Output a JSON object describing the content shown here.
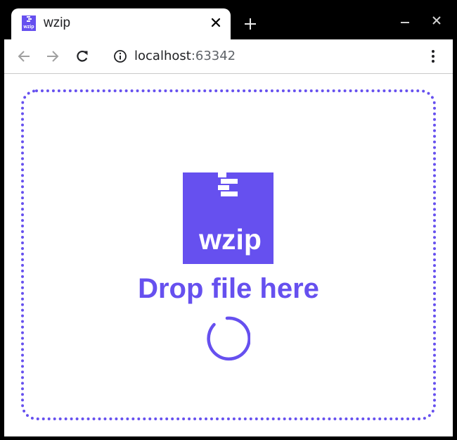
{
  "browser": {
    "tab": {
      "title": "wzip",
      "favicon_label": "wzip"
    },
    "address": {
      "host": "localhost",
      "port": ":63342"
    }
  },
  "dropzone": {
    "logo_text": "wzip",
    "message": "Drop file here",
    "loading": true
  },
  "colors": {
    "accent": "#6650ef",
    "chrome": "#000000",
    "page_bg": "#ffffff",
    "icon_gray": "#5f6368"
  }
}
